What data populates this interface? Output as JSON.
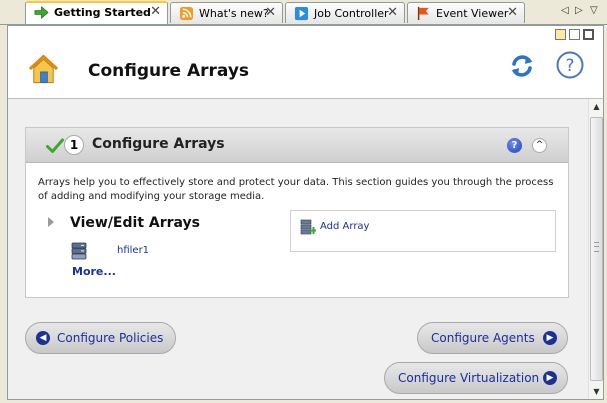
{
  "tabs": [
    {
      "label": "Getting Started",
      "icon": "arrow-right-icon",
      "active": true
    },
    {
      "label": "What's new?",
      "icon": "rss-icon",
      "active": false
    },
    {
      "label": "Job Controller",
      "icon": "play-icon",
      "active": false
    },
    {
      "label": "Event Viewer",
      "icon": "flag-icon",
      "active": false
    }
  ],
  "tab_close_glyph": "✕",
  "tab_nav": {
    "left": "◁",
    "right": "▷",
    "menu": "▽"
  },
  "header": {
    "title": "Configure Arrays",
    "help_glyph": "?"
  },
  "panel": {
    "step_number": "1",
    "title": "Configure Arrays",
    "help_glyph": "?",
    "collapse_glyph": "^",
    "description": "Arrays help you to effectively store and protect your data. This section guides you through the process of adding and modifying your storage media.",
    "subsection_title": "View/Edit Arrays",
    "array_item": "hfiler1",
    "more_label": "More...",
    "add_array_label": "Add Array"
  },
  "nav_buttons": {
    "configure_policies": "Configure Policies",
    "configure_agents": "Configure Agents",
    "configure_virtualization": "Configure Virtualization",
    "arrow_left": "◀",
    "arrow_right": "▶"
  },
  "colors": {
    "active_tab_accent": "#ffc53d",
    "link_blue": "#1a2f9c",
    "nav_circle": "#1b3193"
  }
}
